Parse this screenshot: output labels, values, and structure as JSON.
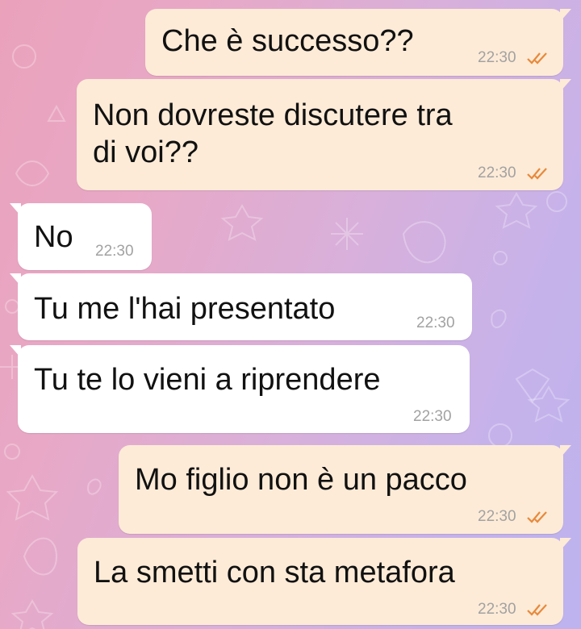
{
  "messages": [
    {
      "text": "Che è successo??",
      "time": "22:30",
      "direction": "outgoing",
      "status": "read"
    },
    {
      "text": "Non dovreste discutere tra\ndi voi??",
      "time": "22:30",
      "direction": "outgoing",
      "status": "read"
    },
    {
      "text": "No",
      "time": "22:30",
      "direction": "incoming"
    },
    {
      "text": "Tu me l'hai presentato",
      "time": "22:30",
      "direction": "incoming"
    },
    {
      "text": "Tu te lo vieni a riprendere",
      "time": "22:30",
      "direction": "incoming"
    },
    {
      "text": "Mo figlio non è un pacco",
      "time": "22:30",
      "direction": "outgoing",
      "status": "read"
    },
    {
      "text": "La smetti con sta metafora",
      "time": "22:30",
      "direction": "outgoing",
      "status": "read"
    }
  ],
  "colors": {
    "outgoing_bubble": "#fdebd7",
    "incoming_bubble": "#ffffff",
    "read_ticks": "#e8893b",
    "timestamp": "#a2a2a2"
  },
  "icons": {
    "read_receipt": "double-check-icon",
    "wallpaper": "doodle-pattern"
  }
}
